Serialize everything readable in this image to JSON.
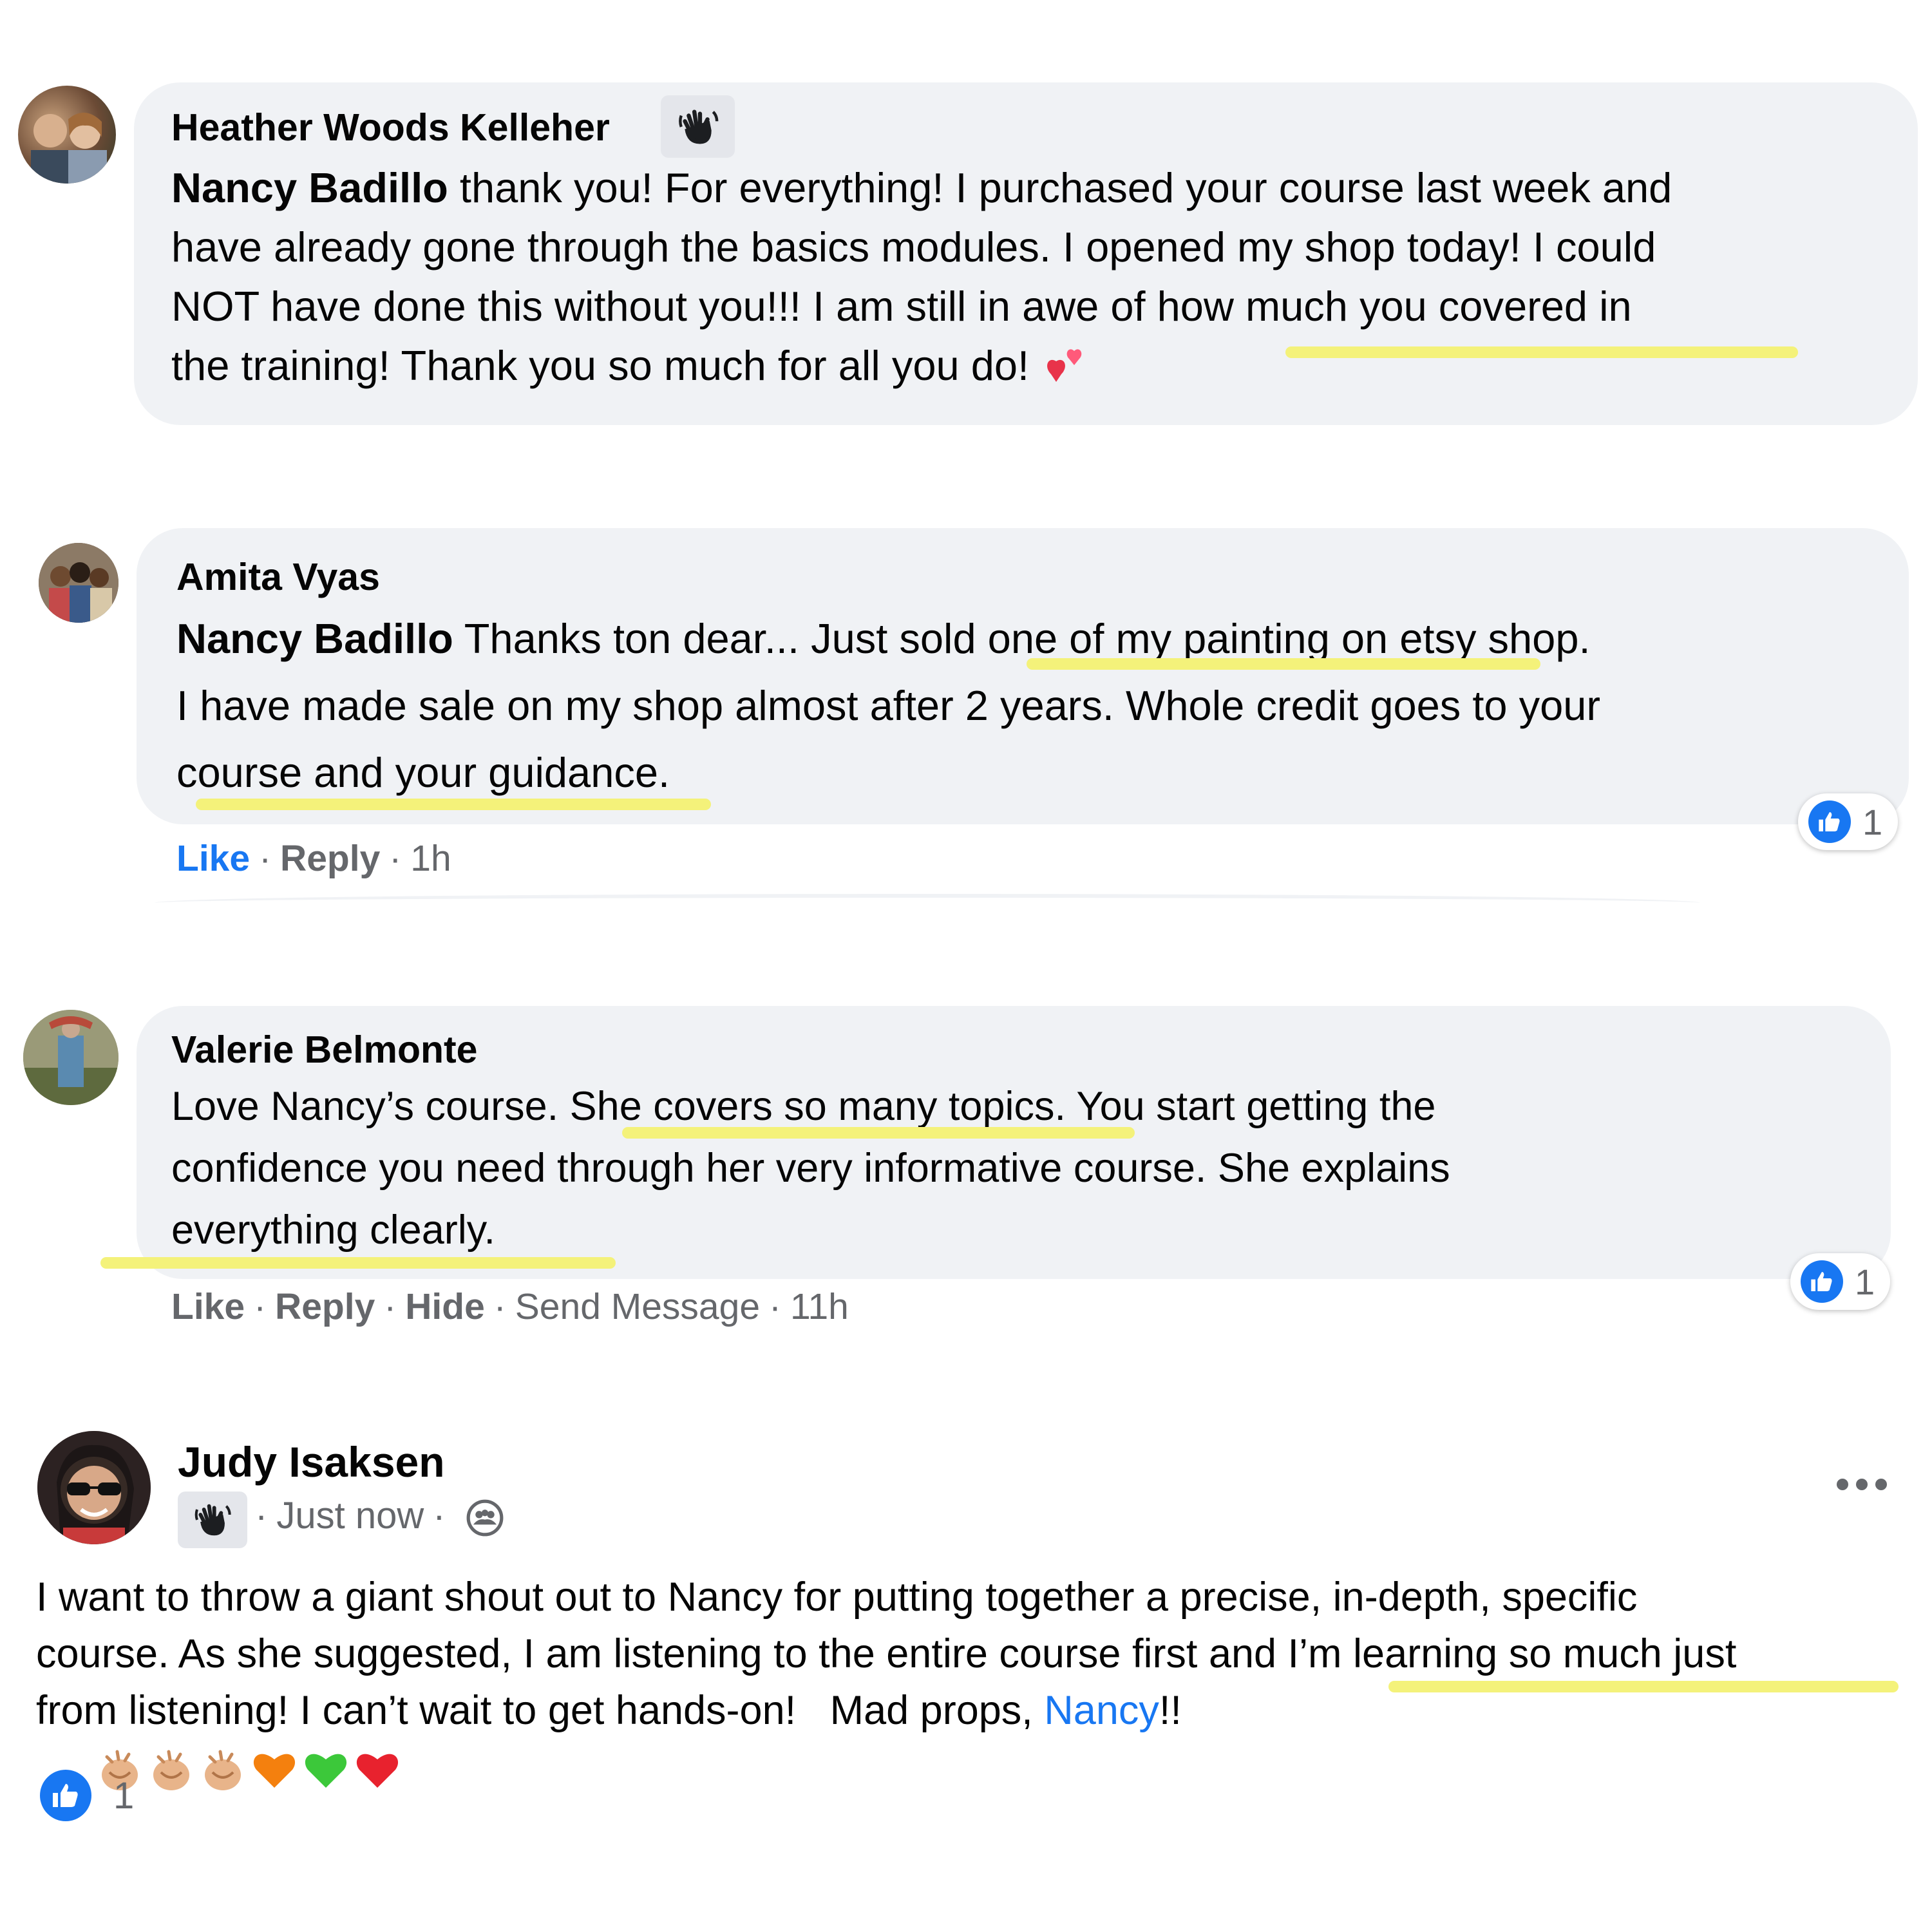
{
  "comments": [
    {
      "author": "Heather Woods Kelleher",
      "badge_icon": "waving-hand-icon",
      "mention": "Nancy Badillo",
      "lines": [
        " thank you! For everything! I purchased your course last week and",
        "have already gone through the basics modules. I opened my shop today! I could",
        "NOT have done this without you!!! I am still in awe of how much you covered in",
        "the training! Thank you so much for all you do!"
      ],
      "emoji": "two-hearts-icon"
    },
    {
      "author": "Amita Vyas",
      "mention": "Nancy Badillo",
      "lines": [
        " Thanks ton dear... Just sold one of my painting on etsy shop.",
        "I have made sale on my shop almost after 2 years. Whole credit goes to your",
        "course and your guidance."
      ],
      "actions": {
        "like": "Like",
        "reply": "Reply",
        "time": "1h"
      },
      "reaction_count": "1"
    },
    {
      "author": "Valerie Belmonte",
      "lines": [
        "Love Nancy’s course. She covers so many topics. You start getting the",
        "confidence you need through her very informative course. She explains",
        "everything clearly."
      ],
      "actions": {
        "like": "Like",
        "reply": "Reply",
        "hide": "Hide",
        "send": "Send Message",
        "time": "11h"
      },
      "reaction_count": "1"
    }
  ],
  "post": {
    "author": "Judy Isaksen",
    "badge_icon": "waving-hand-icon",
    "time": "Just now",
    "audience_icon": "group-icon",
    "more_icon": "more-options-icon",
    "lines": [
      "I want to throw a giant shout out to Nancy for putting together a precise, in-depth, specific",
      "course. As she suggested, I am listening to the entire course first and I’m learning so much just",
      "from listening! I can’t wait to get hands-on!   Mad props, "
    ],
    "link": "Nancy",
    "after_link": "!!",
    "emojis": [
      "clapping-hands-icon",
      "clapping-hands-icon",
      "clapping-hands-icon",
      "orange-heart-icon",
      "green-heart-icon",
      "red-heart-icon"
    ],
    "reaction_count": "1"
  },
  "colors": {
    "bubble": "#f0f2f5",
    "accent": "#1877f2",
    "highlight": "#f4f27a",
    "muted": "#65676b"
  }
}
